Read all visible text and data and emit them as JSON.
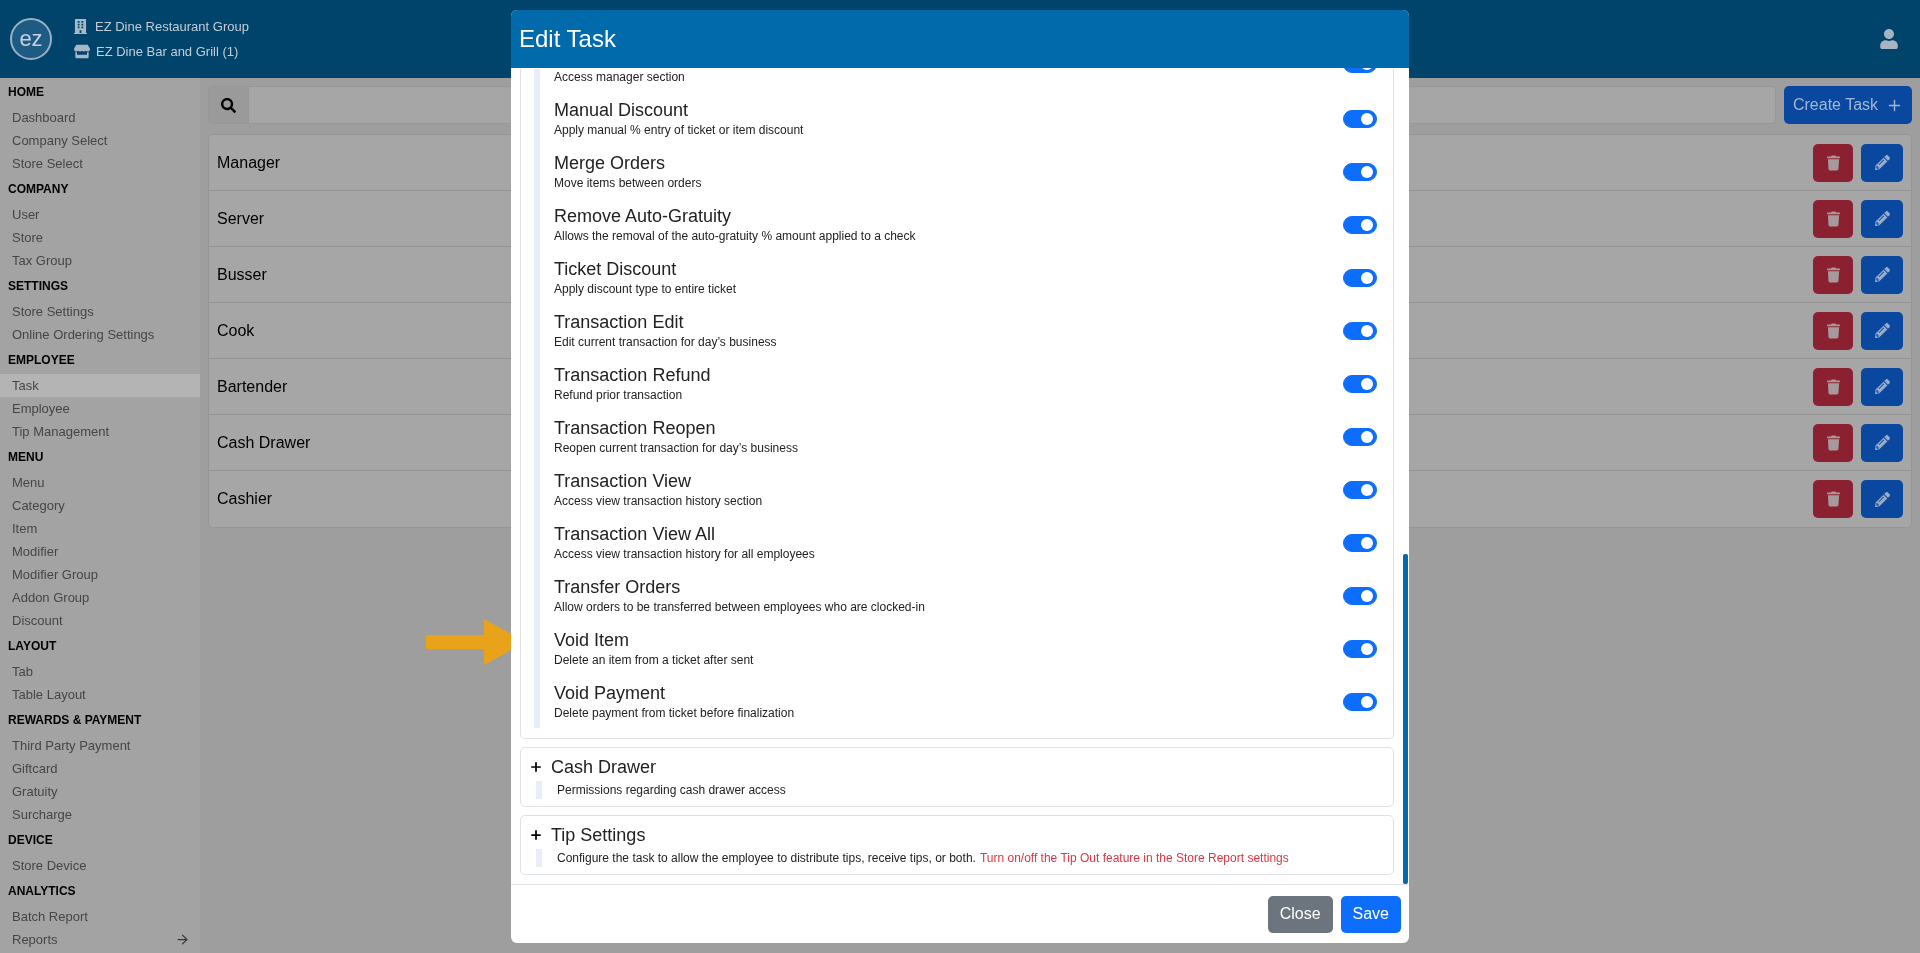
{
  "header": {
    "company": "EZ Dine Restaurant Group",
    "store": "EZ Dine Bar and Grill (1)",
    "logo": "ez"
  },
  "sidebar": [
    {
      "heading": "HOME",
      "items": [
        {
          "label": "Dashboard",
          "selected": false,
          "kind": "plain"
        },
        {
          "label": "Company Select",
          "selected": false,
          "kind": "plain"
        },
        {
          "label": "Store Select",
          "selected": false,
          "kind": "plain"
        }
      ]
    },
    {
      "heading": "COMPANY",
      "items": [
        {
          "label": "User",
          "selected": false,
          "kind": "plain"
        },
        {
          "label": "Store",
          "selected": false,
          "kind": "plain"
        },
        {
          "label": "Tax Group",
          "selected": false,
          "kind": "plain"
        }
      ]
    },
    {
      "heading": "SETTINGS",
      "items": [
        {
          "label": "Store Settings",
          "selected": false,
          "kind": "plain"
        },
        {
          "label": "Online Ordering Settings",
          "selected": false,
          "kind": "plain"
        }
      ]
    },
    {
      "heading": "EMPLOYEE",
      "items": [
        {
          "label": "Task",
          "selected": true,
          "kind": "plain"
        },
        {
          "label": "Employee",
          "selected": false,
          "kind": "plain"
        },
        {
          "label": "Tip Management",
          "selected": false,
          "kind": "plain"
        }
      ]
    },
    {
      "heading": "MENU",
      "items": [
        {
          "label": "Menu",
          "selected": false,
          "kind": "plain"
        },
        {
          "label": "Category",
          "selected": false,
          "kind": "plain"
        },
        {
          "label": "Item",
          "selected": false,
          "kind": "plain"
        },
        {
          "label": "Modifier",
          "selected": false,
          "kind": "plain"
        },
        {
          "label": "Modifier Group",
          "selected": false,
          "kind": "plain"
        },
        {
          "label": "Addon Group",
          "selected": false,
          "kind": "plain"
        },
        {
          "label": "Discount",
          "selected": false,
          "kind": "plain"
        }
      ]
    },
    {
      "heading": "LAYOUT",
      "items": [
        {
          "label": "Tab",
          "selected": false,
          "kind": "plain"
        },
        {
          "label": "Table Layout",
          "selected": false,
          "kind": "plain"
        }
      ]
    },
    {
      "heading": "REWARDS & PAYMENT",
      "items": [
        {
          "label": "Third Party Payment",
          "selected": false,
          "kind": "plain"
        },
        {
          "label": "Giftcard",
          "selected": false,
          "kind": "plain"
        },
        {
          "label": "Gratuity",
          "selected": false,
          "kind": "plain"
        },
        {
          "label": "Surcharge",
          "selected": false,
          "kind": "plain"
        }
      ]
    },
    {
      "heading": "DEVICE",
      "items": [
        {
          "label": "Store Device",
          "selected": false,
          "kind": "plain"
        }
      ]
    },
    {
      "heading": "ANALYTICS",
      "items": [
        {
          "label": "Batch Report",
          "selected": false,
          "kind": "plain"
        },
        {
          "label": "Reports",
          "selected": false,
          "kind": "arrow"
        }
      ]
    }
  ],
  "create_button": "Create Task",
  "tasks": [
    "Manager",
    "Server",
    "Busser",
    "Cook",
    "Bartender",
    "Cash Drawer",
    "Cashier"
  ],
  "modal": {
    "title": "Edit Task",
    "permissions": [
      {
        "description": "Access manager section",
        "on": true
      },
      {
        "title": "Manual Discount",
        "description": "Apply manual % entry of ticket or item discount",
        "on": true
      },
      {
        "title": "Merge Orders",
        "description": "Move items between orders",
        "on": true
      },
      {
        "title": "Remove Auto-Gratuity",
        "description": "Allows the removal of the auto-gratuity % amount applied to a check",
        "on": true
      },
      {
        "title": "Ticket Discount",
        "description": "Apply discount type to entire ticket",
        "on": true
      },
      {
        "title": "Transaction Edit",
        "description": "Edit current transaction for day’s business",
        "on": true
      },
      {
        "title": "Transaction Refund",
        "description": "Refund prior transaction",
        "on": true
      },
      {
        "title": "Transaction Reopen",
        "description": "Reopen current transaction for day’s business",
        "on": true
      },
      {
        "title": "Transaction View",
        "description": "Access view transaction history section",
        "on": true
      },
      {
        "title": "Transaction View All",
        "description": "Access view transaction history for all employees",
        "on": true
      },
      {
        "title": "Transfer Orders",
        "description": "Allow orders to be transferred between employees who are clocked-in",
        "on": true
      },
      {
        "title": "Void Item",
        "description": "Delete an item from a ticket after sent",
        "on": true
      },
      {
        "title": "Void Payment",
        "description": "Delete payment from ticket before finalization",
        "on": true
      }
    ],
    "sections": [
      {
        "title": "Cash Drawer",
        "description": "Permissions regarding cash drawer access",
        "expanded": false
      },
      {
        "title": "Tip Settings",
        "description": "Configure the task to allow the employee to distribute tips, receive tips, or both.",
        "note": "Turn on/off the Tip Out feature in the Store Report settings",
        "expanded": false
      }
    ],
    "buttons": [
      {
        "label": "Close",
        "kind": "secondary"
      },
      {
        "label": "Save",
        "kind": "primary"
      }
    ]
  }
}
